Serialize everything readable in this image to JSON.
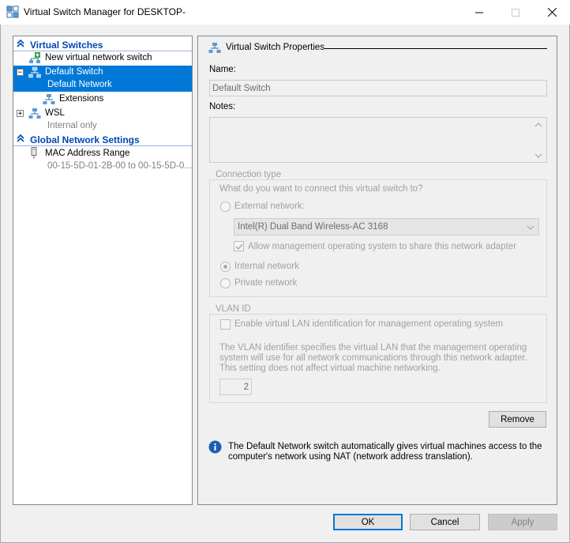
{
  "window": {
    "title": "Virtual Switch Manager for DESKTOP-"
  },
  "left": {
    "virtual_switches_header": "Virtual Switches",
    "new_switch": "New virtual network switch",
    "default_switch": {
      "name": "Default Switch",
      "sub": "Default Network"
    },
    "extensions": "Extensions",
    "wsl": {
      "name": "WSL",
      "sub": "Internal only"
    },
    "global_header": "Global Network Settings",
    "mac": {
      "name": "MAC Address Range",
      "sub": "00-15-5D-01-2B-00 to 00-15-5D-0..."
    }
  },
  "right": {
    "section_title": "Virtual Switch Properties",
    "name_label": "Name:",
    "name_value": "Default Switch",
    "notes_label": "Notes:",
    "notes_value": "",
    "connection_type": {
      "title": "Connection type",
      "question": "What do you want to connect this virtual switch to?",
      "external_label": "External network:",
      "adapter_selected": "Intel(R) Dual Band Wireless-AC 3168",
      "allow_mgmt_label": "Allow management operating system to share this network adapter",
      "internal_label": "Internal network",
      "private_label": "Private network",
      "selected": "internal"
    },
    "vlan": {
      "title": "VLAN ID",
      "enable_label": "Enable virtual LAN identification for management operating system",
      "description": "The VLAN identifier specifies the virtual LAN that the management operating system will use for all network communications through this network adapter. This setting does not affect virtual machine networking.",
      "value": "2"
    },
    "remove_label": "Remove",
    "info_text": "The Default Network switch automatically gives virtual machines access to the computer's network using NAT (network address translation)."
  },
  "footer": {
    "ok_label": "OK",
    "cancel_label": "Cancel",
    "apply_label": "Apply"
  },
  "colors": {
    "selection": "#0078d7",
    "header_blue": "#0046b5",
    "info_icon": "#1a5fb4"
  }
}
